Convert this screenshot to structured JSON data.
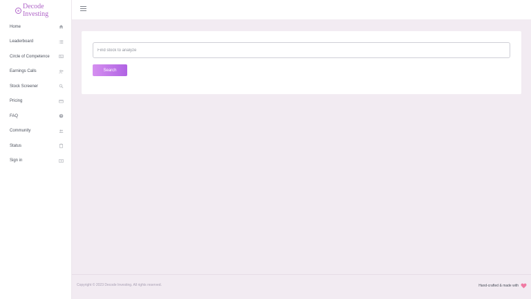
{
  "brand": {
    "name": "Decode Investing",
    "accent": "#b066c8"
  },
  "sidebar": {
    "items": [
      {
        "label": "Home",
        "icon": "home-icon"
      },
      {
        "label": "Leaderboard",
        "icon": "list-icon"
      },
      {
        "label": "Circle of Competence",
        "icon": "card-icon"
      },
      {
        "label": "Earnings Calls",
        "icon": "person-add-icon"
      },
      {
        "label": "Stock Screener",
        "icon": "search-icon"
      },
      {
        "label": "Pricing",
        "icon": "credit-card-icon"
      },
      {
        "label": "FAQ",
        "icon": "question-icon"
      },
      {
        "label": "Community",
        "icon": "people-icon"
      },
      {
        "label": "Status",
        "icon": "clipboard-icon"
      },
      {
        "label": "Sign in",
        "icon": "login-icon"
      }
    ]
  },
  "search": {
    "placeholder": "Find stock to analyze",
    "value": "",
    "button_label": "Search"
  },
  "footer": {
    "copyright": "Copyright © 2023 Decode Investing. All rights reserved.",
    "handcrafted": "Hand-crafted & made with",
    "heart_color": "#f07aa3"
  }
}
